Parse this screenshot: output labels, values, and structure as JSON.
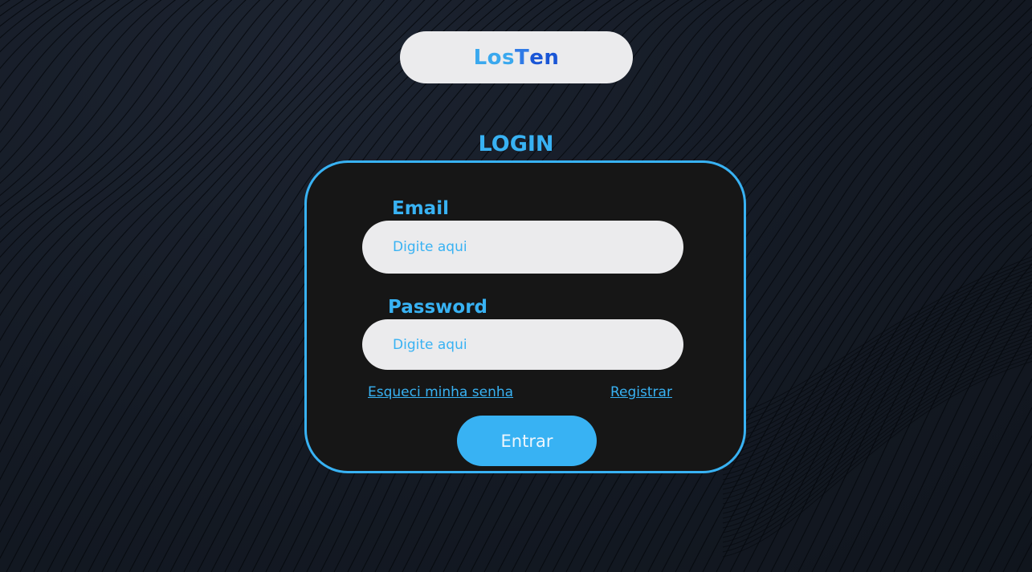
{
  "brand": {
    "part1": "Los",
    "part2_t": "T",
    "part2_rest": "en"
  },
  "login": {
    "title": "LOGIN",
    "email_label": "Email",
    "email_placeholder": "Digite aqui",
    "password_label": "Password",
    "password_placeholder": "Digite aqui",
    "forgot_link": "Esqueci minha senha",
    "register_link": "Registrar",
    "submit_label": "Entrar"
  },
  "colors": {
    "accent": "#38b2f3",
    "card_bg": "#161616",
    "input_bg": "#ebebed",
    "page_bg": "#141a24"
  }
}
